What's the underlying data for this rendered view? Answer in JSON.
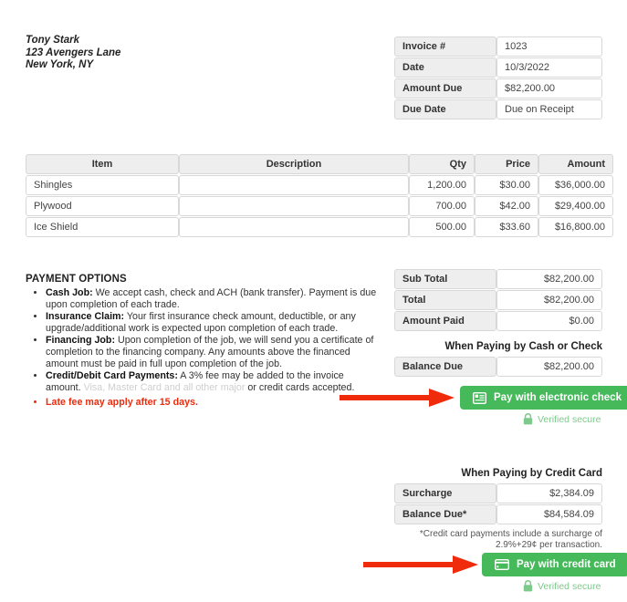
{
  "bill_to": {
    "name": "Tony Stark",
    "address_line1": "123 Avengers Lane",
    "address_line2": "New York, NY"
  },
  "meta": {
    "rows": [
      {
        "label": "Invoice #",
        "value": "1023"
      },
      {
        "label": "Date",
        "value": "10/3/2022"
      },
      {
        "label": "Amount Due",
        "value": "$82,200.00"
      },
      {
        "label": "Due Date",
        "value": "Due on Receipt"
      }
    ]
  },
  "items_table": {
    "headers": [
      "Item",
      "Description",
      "Qty",
      "Price",
      "Amount"
    ],
    "rows": [
      {
        "item": "Shingles",
        "description": "",
        "qty": "1,200.00",
        "price": "$30.00",
        "amount": "$36,000.00"
      },
      {
        "item": "Plywood",
        "description": "",
        "qty": "700.00",
        "price": "$42.00",
        "amount": "$29,400.00"
      },
      {
        "item": "Ice Shield",
        "description": "",
        "qty": "500.00",
        "price": "$33.60",
        "amount": "$16,800.00"
      }
    ]
  },
  "payment_options": {
    "heading": "PAYMENT OPTIONS",
    "bullets": [
      {
        "term": "Cash Job:",
        "text": " We accept cash, check and ACH (bank transfer). Payment is due upon completion of each trade."
      },
      {
        "term": "Insurance Claim:",
        "text": " Your first insurance check amount, deductible, or any upgrade/additional work is expected upon completion of each trade."
      },
      {
        "term": "Financing Job:",
        "text": " Upon completion of the job, we will send you a certificate of completion to the financing company. Any amounts above the financed amount must be paid in full upon completion of the job."
      },
      {
        "term": "Credit/Debit Card Payments:",
        "text": " A 3% fee may be added to the invoice amount. ",
        "faded_text": "Visa, Master Card and all other major",
        "tail_text": " or credit cards accepted."
      }
    ],
    "late_fee": "Late fee may apply after 15 days."
  },
  "totals": {
    "rows": [
      {
        "label": "Sub Total",
        "value": "$82,200.00"
      },
      {
        "label": "Total",
        "value": "$82,200.00"
      },
      {
        "label": "Amount Paid",
        "value": "$0.00"
      }
    ]
  },
  "cash_section": {
    "heading": "When Paying by Cash or Check",
    "rows": [
      {
        "label": "Balance Due",
        "value": "$82,200.00"
      }
    ],
    "button_label": "Pay with electronic check",
    "verified_label": "Verified secure"
  },
  "card_section": {
    "heading": "When Paying by Credit Card",
    "rows": [
      {
        "label": "Surcharge",
        "value": "$2,384.09"
      },
      {
        "label": "Balance Due*",
        "value": "$84,584.09"
      }
    ],
    "footnote_line1": "*Credit card payments include a surcharge of",
    "footnote_line2": "2.9%+29¢ per transaction.",
    "button_label": "Pay with credit card",
    "verified_label": "Verified secure"
  },
  "colors": {
    "button_green": "#46b95a",
    "verified_green": "#7ec98c",
    "arrow_red": "#ef2b0c",
    "late_fee_red": "#ef2b0c",
    "header_gray": "#eeeeee",
    "border_gray": "#d8d8d8"
  },
  "icons": {
    "echeck": "electronic-check-icon",
    "credit_card": "credit-card-icon",
    "lock": "lock-icon",
    "arrow": "arrow-right-annotation"
  }
}
